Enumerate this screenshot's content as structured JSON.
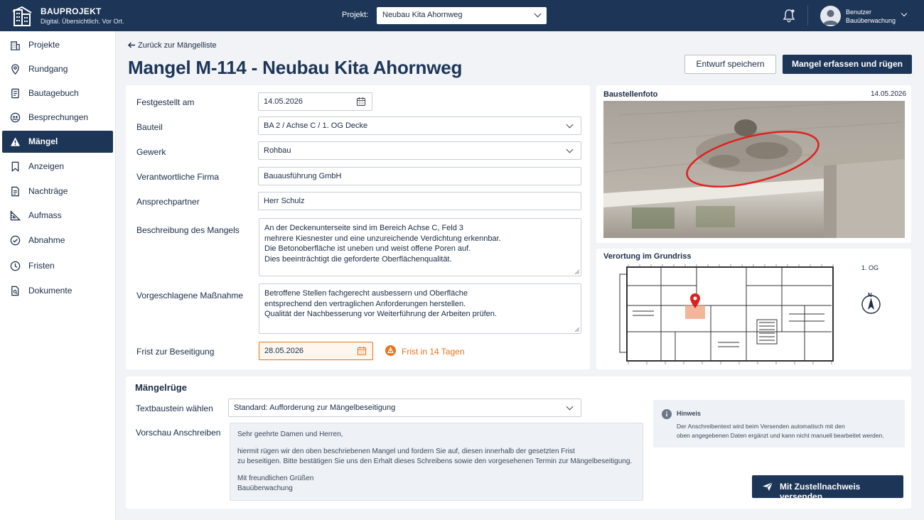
{
  "header": {
    "brand_title": "BAUPROJEKT",
    "brand_subtitle": "Digital. Übersichtlich. Vor Ort.",
    "project_label": "Projekt:",
    "project_value": "Neubau Kita Ahornweg",
    "user_role": "Benutzer",
    "user_name": "Bauüberwachung"
  },
  "sidebar": {
    "items": [
      {
        "label": "Projekte",
        "icon": "building-icon"
      },
      {
        "label": "Rundgang",
        "icon": "location-pin-icon"
      },
      {
        "label": "Bautagebuch",
        "icon": "notebook-icon"
      },
      {
        "label": "Besprechungen",
        "icon": "people-icon"
      },
      {
        "label": "Mängel",
        "icon": "warning-icon",
        "active": true
      },
      {
        "label": "Anzeigen",
        "icon": "bookmark-icon"
      },
      {
        "label": "Nachträge",
        "icon": "document-icon"
      },
      {
        "label": "Aufmass",
        "icon": "ruler-icon"
      },
      {
        "label": "Abnahme",
        "icon": "check-circle-icon"
      },
      {
        "label": "Fristen",
        "icon": "clock-icon"
      },
      {
        "label": "Dokumente",
        "icon": "file-search-icon"
      }
    ]
  },
  "page": {
    "back_link": "Zurück zur Mängelliste",
    "title": "Mangel M-114 - Neubau Kita Ahornweg",
    "draft_button": "Entwurf speichern",
    "submit_button": "Mangel erfassen und rügen"
  },
  "form": {
    "date_label": "Festgestellt am",
    "date_value": "14.05.2026",
    "component_label": "Bauteil",
    "component_value": "BA 2 / Achse C / 1. OG Decke",
    "trade_label": "Gewerk",
    "trade_value": "Rohbau",
    "company_label": "Verantwortliche Firma",
    "company_value": "Bauausführung GmbH",
    "contact_label": "Ansprechpartner",
    "contact_value": "Herr Schulz",
    "description_label": "Beschreibung des Mangels",
    "description_lines": [
      "An der Deckenunterseite sind im Bereich Achse C, Feld 3",
      "mehrere Kiesnester und eine unzureichende Verdichtung erkennbar.",
      "Die Betonoberfläche ist uneben und weist offene Poren auf.",
      "Dies beeinträchtigt die geforderte Oberflächenqualität."
    ],
    "measure_label": "Vorgeschlagene Maßnahme",
    "measure_lines": [
      "Betroffene Stellen fachgerecht ausbessern und Oberfläche",
      "entsprechend den vertraglichen Anforderungen herstellen.",
      "Qualität der Nachbesserung vor Weiterführung der Arbeiten prüfen."
    ],
    "deadline_label": "Frist zur Beseitigung",
    "deadline_value": "28.05.2026",
    "deadline_note": "Frist in 14 Tagen"
  },
  "photo": {
    "title": "Baustellenfoto",
    "date": "14.05.2026"
  },
  "floorplan": {
    "title": "Verortung im Grundriss",
    "floor": "1. OG",
    "north": "N"
  },
  "notice": {
    "section_title": "Mängelrüge",
    "template_label": "Textbaustein wählen",
    "template_value": "Standard: Aufforderung zur Mängelbeseitigung",
    "preview_label": "Vorschau Anschreiben",
    "preview_greeting": "Sehr geehrte Damen und Herren,",
    "preview_body_1": "hiermit rügen wir den oben beschriebenen Mangel und fordern Sie auf, diesen innerhalb der gesetzten Frist",
    "preview_body_2": "zu beseitigen. Bitte bestätigen Sie uns den Erhalt dieses Schreibens sowie den vorgesehenen Termin zur Mängelbeseitigung.",
    "preview_closing": "Mit freundlichen Grüßen",
    "preview_sender": "Bauüberwachung",
    "hint_title": "Hinweis",
    "hint_line_1": "Der Anschreibentext wird beim Versenden automatisch mit den",
    "hint_line_2": "oben angegebenen Daten ergänzt und kann nicht manuell bearbeitet werden.",
    "send_button": "Mit Zustellnachweis versenden"
  },
  "colors": {
    "primary": "#1d3557",
    "warning": "#e8741e",
    "marker": "#e0201e"
  }
}
